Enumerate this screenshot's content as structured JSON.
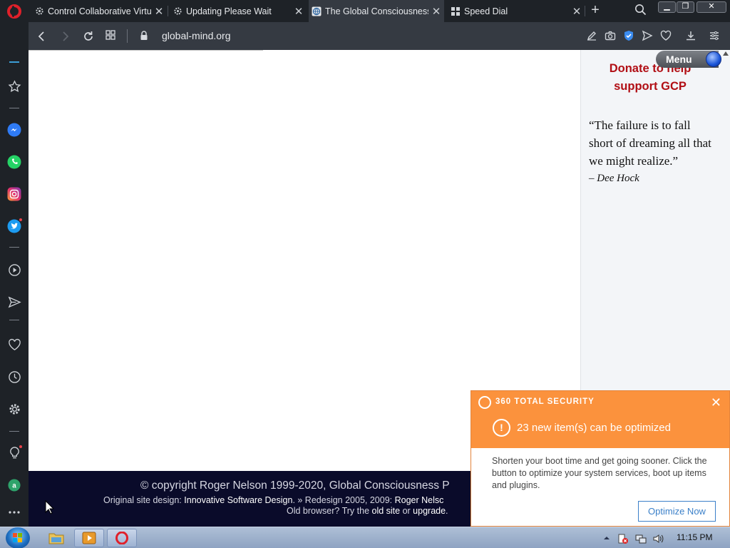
{
  "browser": {
    "tabs": [
      {
        "title": "Control Collaborative Virtu",
        "icon": "gear-icon"
      },
      {
        "title": "Updating Please Wait",
        "icon": "gear-icon"
      },
      {
        "title": "The Global Consciousness",
        "icon": "globe-icon",
        "active": true
      },
      {
        "title": "Speed Dial",
        "icon": "grid-icon"
      }
    ],
    "url": "global-mind.org"
  },
  "page": {
    "menu_label": "Menu",
    "donate_text": "Donate to help support GCP",
    "quote": "“The failure is to fall short of dreaming all that we might realize.”",
    "quote_author": "– Dee Hock"
  },
  "footer": {
    "copyright": "© copyright Roger Nelson 1999-2020, Global Consciousness P",
    "design_prefix": "Original site design: ",
    "design_link": "Innovative Software Design",
    "redesign_prefix": ". » Redesign 2005, 2009: ",
    "redesign_link": "Roger Nelsc",
    "old_prefix": "Old browser? Try the ",
    "old_site": "old site",
    "or": " or ",
    "upgrade": "upgrade",
    "period": "."
  },
  "popup": {
    "brand": "360 TOTAL SECURITY",
    "message": "23 new item(s) can be optimized",
    "body": "Shorten your boot time and get going sooner. Click the button to optimize your system services, boot up items and plugins.",
    "button": "Optimize Now"
  },
  "taskbar": {
    "time": "11:15 PM"
  }
}
